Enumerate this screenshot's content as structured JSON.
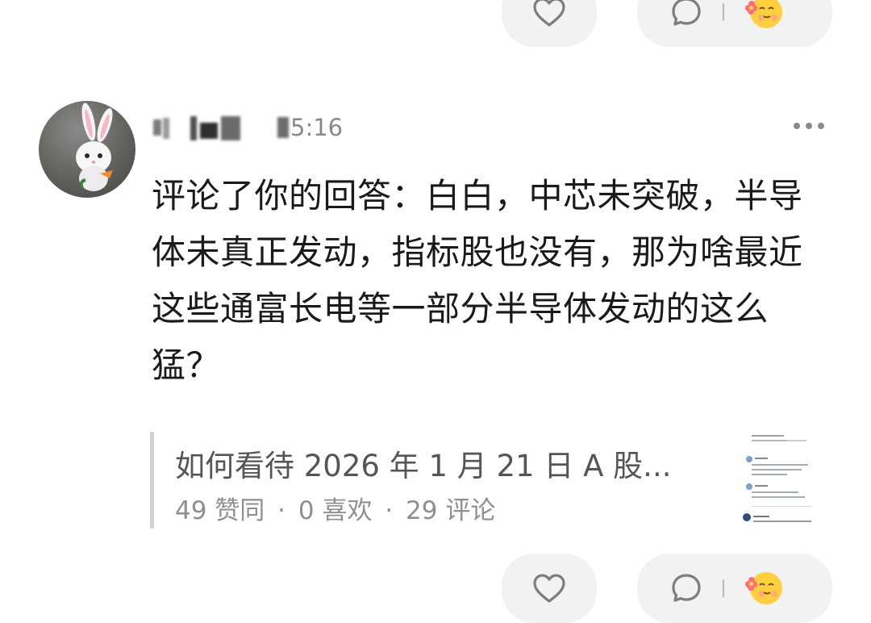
{
  "actions": {
    "like_icon": "heart-outline-icon",
    "comment_icon": "comment-bubble-icon",
    "emoji_icon": "flower-smile-emoji-icon"
  },
  "comment": {
    "timestamp": "5:16",
    "text": "评论了你的回答：白白，中芯未突破，半导体未真正发动，指标股也没有，那为啥最近这些通富长电等一部分半导体发动的这么猛？"
  },
  "quote": {
    "title": "如何看待 2026 年 1 月 21 日 A 股...",
    "likes": "49 赞同",
    "favorites": "0 喜欢",
    "comments": "29 评论",
    "separator": "·"
  },
  "colors": {
    "pill_bg": "#f2f2f3",
    "text_primary": "#1a1a1a",
    "text_secondary": "#8f8f8f",
    "quote_bar": "#d2d2d4"
  }
}
